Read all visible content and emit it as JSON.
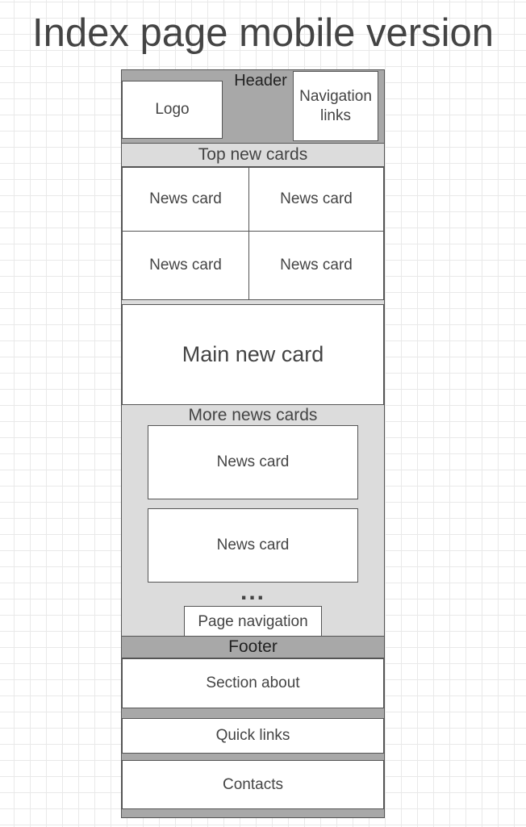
{
  "title": "Index page mobile version",
  "header": {
    "label": "Header",
    "logo": "Logo",
    "nav_links": "Navigation links"
  },
  "top_news": {
    "label": "Top new cards",
    "cards": [
      "News card",
      "News card",
      "News card",
      "News card"
    ]
  },
  "main_card": "Main new card",
  "more_news": {
    "label": "More news cards",
    "cards": [
      "News card",
      "News card"
    ],
    "ellipsis": "...",
    "page_navigation": "Page navigation"
  },
  "footer": {
    "label": "Footer",
    "section_about": "Section about",
    "quick_links": "Quick links",
    "contacts": "Contacts"
  },
  "colors": {
    "frame_light": "#dcdcdc",
    "frame_dark": "#a8a8a8",
    "box": "#ffffff",
    "text": "#444444",
    "grid": "#e9e9e9"
  }
}
